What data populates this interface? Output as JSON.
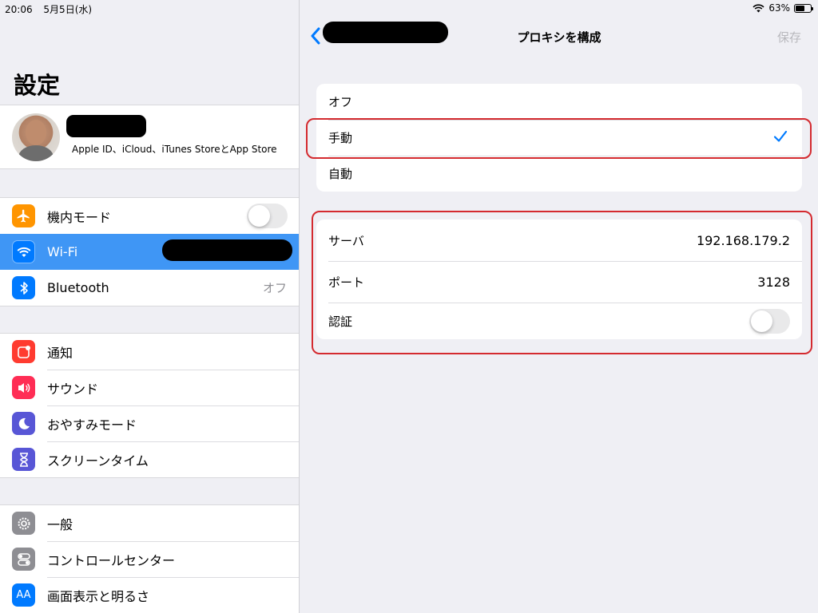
{
  "status_bar": {
    "time": "20:06",
    "date": "5月5日(水)",
    "battery_percent": "63%",
    "battery_level": 0.63
  },
  "sidebar": {
    "title": "設定",
    "profile": {
      "subtitle": "Apple ID、iCloud、iTunes StoreとApp Store"
    },
    "groups": [
      {
        "items": [
          {
            "label": "機内モード",
            "icon": "airplane-icon",
            "color": "#ff9500",
            "toggle": false
          },
          {
            "label": "Wi-Fi",
            "icon": "wifi-icon",
            "color": "#007aff",
            "selected": true
          },
          {
            "label": "Bluetooth",
            "icon": "bluetooth-icon",
            "color": "#007aff",
            "value": "オフ"
          }
        ]
      },
      {
        "items": [
          {
            "label": "通知",
            "icon": "notifications-icon",
            "color": "#ff3b30"
          },
          {
            "label": "サウンド",
            "icon": "sound-icon",
            "color": "#ff2d55"
          },
          {
            "label": "おやすみモード",
            "icon": "moon-icon",
            "color": "#5856d6"
          },
          {
            "label": "スクリーンタイム",
            "icon": "hourglass-icon",
            "color": "#5856d6"
          }
        ]
      },
      {
        "items": [
          {
            "label": "一般",
            "icon": "gear-icon",
            "color": "#8e8e93"
          },
          {
            "label": "コントロールセンター",
            "icon": "control-center-icon",
            "color": "#8e8e93"
          },
          {
            "label": "画面表示と明るさ",
            "icon": "display-icon",
            "color": "#007aff",
            "glyph": "AA"
          }
        ]
      }
    ]
  },
  "detail": {
    "title": "プロキシを構成",
    "save_label": "保存",
    "modes": [
      {
        "label": "オフ",
        "checked": false
      },
      {
        "label": "手動",
        "checked": true
      },
      {
        "label": "自動",
        "checked": false
      }
    ],
    "server_label": "サーバ",
    "server_value": "192.168.179.2",
    "port_label": "ポート",
    "port_value": "3128",
    "auth_label": "認証",
    "auth_enabled": false
  },
  "colors": {
    "accent": "#007aff",
    "selection": "#3f96f5",
    "annotation": "#d42a2f"
  }
}
